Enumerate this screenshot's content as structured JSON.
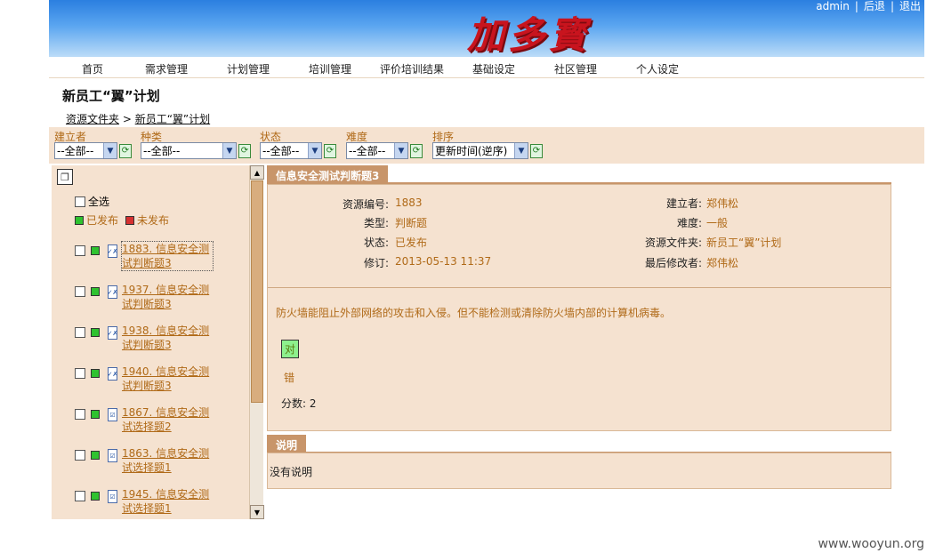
{
  "header": {
    "logo_text": "加多寳",
    "links": [
      "admin",
      "后退",
      "退出"
    ],
    "colors": {
      "banner_top": "#2b7fe0",
      "banner_bottom": "#bcdcf8",
      "logo": "#c8141e"
    }
  },
  "nav": {
    "items": [
      "首页",
      "需求管理",
      "计划管理",
      "培训管理",
      "评价培训结果",
      "基础设定",
      "社区管理",
      "个人设定"
    ]
  },
  "page": {
    "title": "新员工“翼”计划",
    "breadcrumb": {
      "root": "资源文件夹",
      "separator": " > ",
      "current": "新员工“翼”计划"
    }
  },
  "filters": [
    {
      "label": "建立者",
      "value": "--全部--"
    },
    {
      "label": "种类",
      "value": "--全部--"
    },
    {
      "label": "状态",
      "value": "--全部--"
    },
    {
      "label": "难度",
      "value": "--全部--"
    },
    {
      "label": "排序",
      "value": "更新时间(逆序)"
    }
  ],
  "left_panel": {
    "select_all_label": "全选",
    "legend": {
      "published": "已发布",
      "unpublished": "未发布"
    },
    "items": [
      {
        "title": "1883. 信息安全测试判断题3",
        "status": "published",
        "icon": "judge-doc-icon"
      },
      {
        "title": "1937. 信息安全测试判断题3",
        "status": "published",
        "icon": "judge-doc-icon"
      },
      {
        "title": "1938. 信息安全测试判断题3",
        "status": "published",
        "icon": "judge-doc-icon"
      },
      {
        "title": "1940. 信息安全测试判断题3",
        "status": "published",
        "icon": "judge-doc-icon"
      },
      {
        "title": "1867. 信息安全测试选择题2",
        "status": "published",
        "icon": "choice-doc-icon"
      },
      {
        "title": "1863. 信息安全测试选择题1",
        "status": "published",
        "icon": "choice-doc-icon"
      },
      {
        "title": "1945. 信息安全测试选择题1",
        "status": "published",
        "icon": "choice-doc-icon"
      }
    ]
  },
  "detail": {
    "tab_title": "信息安全测试判断题3",
    "fields_left": [
      {
        "label": "资源编号:",
        "value": "1883"
      },
      {
        "label": "类型:",
        "value": "判断题"
      },
      {
        "label": "状态:",
        "value": "已发布"
      },
      {
        "label": "修订:",
        "value": "2013-05-13 11:37"
      }
    ],
    "fields_right": [
      {
        "label": "建立者:",
        "value": "郑伟松"
      },
      {
        "label": "难度:",
        "value": "一般"
      },
      {
        "label": "资源文件夹:",
        "value": "新员工“翼”计划"
      },
      {
        "label": "最后修改者:",
        "value": "郑伟松"
      }
    ],
    "question": "防火墙能阻止外部网络的攻击和入侵。但不能检测或清除防火墙内部的计算机病毒。",
    "option_correct": "对",
    "option_wrong": "错",
    "score_label": "分数: 2"
  },
  "notes": {
    "tab_title": "说明",
    "text": "没有说明"
  },
  "watermark": "www.wooyun.org"
}
